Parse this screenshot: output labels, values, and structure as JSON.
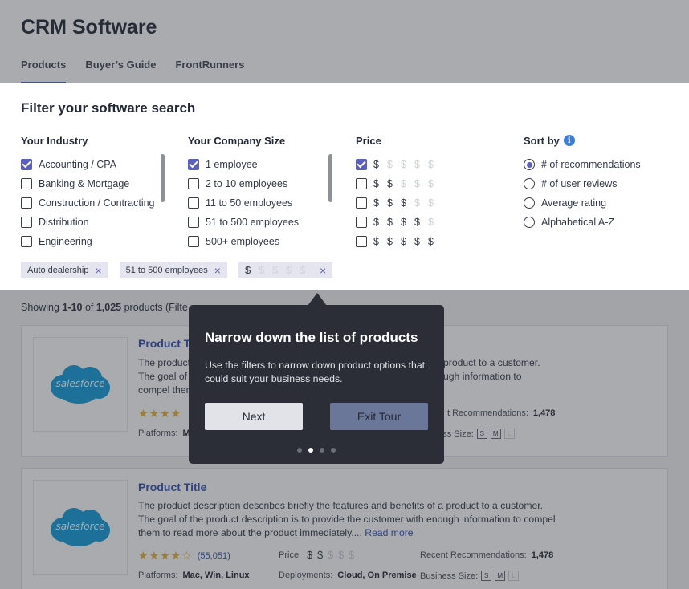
{
  "header": {
    "title": "CRM Software",
    "tabs": [
      {
        "label": "Products",
        "active": true
      },
      {
        "label": "Buyer’s Guide",
        "active": false
      },
      {
        "label": "FrontRunners",
        "active": false
      }
    ]
  },
  "filters": {
    "title": "Filter your software search",
    "industry": {
      "title": "Your Industry",
      "options": [
        {
          "label": "Accounting / CPA",
          "checked": true
        },
        {
          "label": "Banking & Mortgage",
          "checked": false
        },
        {
          "label": "Construction / Contracting",
          "checked": false
        },
        {
          "label": "Distribution",
          "checked": false
        },
        {
          "label": "Engineering",
          "checked": false
        }
      ]
    },
    "company_size": {
      "title": "Your Company Size",
      "options": [
        {
          "label": "1 employee",
          "checked": true
        },
        {
          "label": "2 to 10 employees",
          "checked": false
        },
        {
          "label": "11 to 50 employees",
          "checked": false
        },
        {
          "label": "51 to 500 employees",
          "checked": false
        },
        {
          "label": "500+ employees",
          "checked": false
        }
      ]
    },
    "price": {
      "title": "Price",
      "symbol": "$",
      "options": [
        {
          "level": 1,
          "checked": true
        },
        {
          "level": 2,
          "checked": false
        },
        {
          "level": 3,
          "checked": false
        },
        {
          "level": 4,
          "checked": false
        },
        {
          "level": 5,
          "checked": false
        }
      ]
    },
    "sort": {
      "title": "Sort by",
      "info_icon": "i",
      "options": [
        {
          "label": "# of recommendations",
          "checked": true
        },
        {
          "label": "# of user reviews",
          "checked": false
        },
        {
          "label": "Average rating",
          "checked": false
        },
        {
          "label": "Alphabetical A-Z",
          "checked": false
        }
      ]
    },
    "chips": {
      "chip1": "Auto dealership",
      "chip2": "51 to 500 employees",
      "chip3_price_level": 1,
      "remove_icon": "×"
    }
  },
  "results": {
    "showing_prefix": "Showing ",
    "showing_range": "1-10",
    "showing_of": " of ",
    "showing_total": "1,025",
    "showing_suffix": " products (Filte"
  },
  "products": [
    {
      "title": "Product Title",
      "logo_text": "salesforce",
      "desc_visible": "The product",
      "desc_line2": "The goal of",
      "desc_line3": "compel them",
      "desc_right1": "product to a customer.",
      "desc_right2": "ugh information to",
      "rec_label": "t Recommendations:",
      "rec_value": "1,478",
      "platforms_label": "Platforms:",
      "platforms_value": "M",
      "size_label": "ness Size:",
      "sizes": [
        "S",
        "M",
        "L"
      ]
    },
    {
      "title": "Product Title",
      "logo_text": "salesforce",
      "description": "The product description describes briefly the features and benefits of a product to a customer. The goal of the product description is to provide the customer with enough information to compel them to read more about the product immediately....",
      "read_more": "Read more",
      "reviews": "(55,051)",
      "rating": 4,
      "price_label": "Price",
      "price_level": 2,
      "rec_label": "Recent Recommendations:",
      "rec_value": "1,478",
      "platforms_label": "Platforms:",
      "platforms_value": "Mac, Win, Linux",
      "deploy_label": "Deployments:",
      "deploy_value": "Cloud, On Premise",
      "size_label": "Business Size:",
      "sizes": [
        "S",
        "M",
        "L"
      ]
    }
  ],
  "tour": {
    "title": "Narrow down the list of products",
    "body": "Use the filters to narrow down product options that could suit your business needs.",
    "next_label": "Next",
    "exit_label": "Exit Tour",
    "step": 2,
    "total_steps": 4
  },
  "colors": {
    "accent": "#5b5fc0",
    "link": "#3a58b8",
    "star": "#e7b53f",
    "tour_bg": "#2b2e36"
  }
}
